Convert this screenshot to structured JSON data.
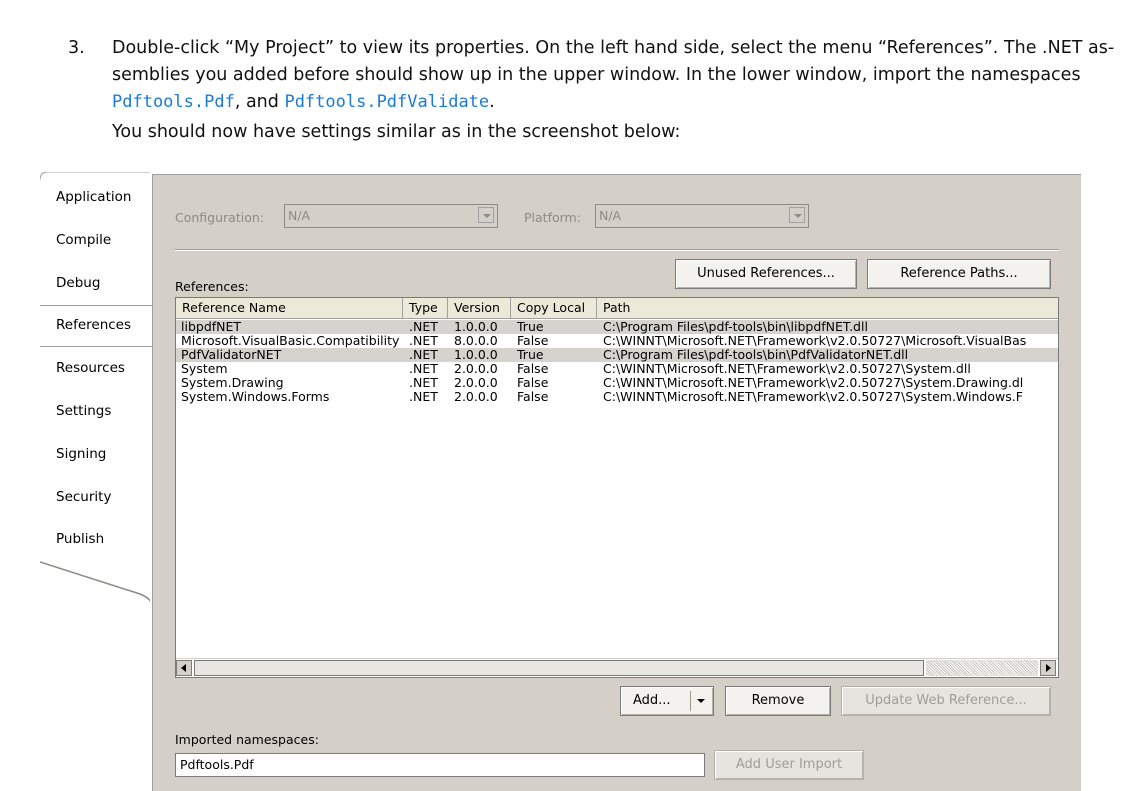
{
  "instruction": {
    "number": "3.",
    "line1": "Double-click “My Project” to view its properties. On the left hand side, select the menu “References”. The .NET as-",
    "line2": "semblies you added before should show up in the upper window. In the lower window, import the namespaces",
    "ns1": "Pdftools.Pdf",
    "mid": ", and ",
    "ns2": "Pdftools.PdfValidate",
    "end": ".",
    "line4": "You should now have settings similar as in the screenshot below:"
  },
  "sidebar": {
    "tabs": [
      "Application",
      "Compile",
      "Debug",
      "References",
      "Resources",
      "Settings",
      "Signing",
      "Security",
      "Publish"
    ],
    "active": "References"
  },
  "config": {
    "configuration_label": "Configuration:",
    "configuration_value": "N/A",
    "platform_label": "Platform:",
    "platform_value": "N/A"
  },
  "references": {
    "label": "References:",
    "unused_button": "Unused References...",
    "paths_button": "Reference Paths...",
    "columns": [
      "Reference Name",
      "Type",
      "Version",
      "Copy Local",
      "Path"
    ],
    "rows": [
      {
        "name": "libpdfNET",
        "type": ".NET",
        "version": "1.0.0.0",
        "copy": "True",
        "path": "C:\\Program Files\\pdf-tools\\bin\\libpdfNET.dll",
        "selected": true
      },
      {
        "name": "Microsoft.VisualBasic.Compatibility",
        "type": ".NET",
        "version": "8.0.0.0",
        "copy": "False",
        "path": "C:\\WINNT\\Microsoft.NET\\Framework\\v2.0.50727\\Microsoft.VisualBas",
        "selected": false
      },
      {
        "name": "PdfValidatorNET",
        "type": ".NET",
        "version": "1.0.0.0",
        "copy": "True",
        "path": "C:\\Program Files\\pdf-tools\\bin\\PdfValidatorNET.dll",
        "selected": true
      },
      {
        "name": "System",
        "type": ".NET",
        "version": "2.0.0.0",
        "copy": "False",
        "path": "C:\\WINNT\\Microsoft.NET\\Framework\\v2.0.50727\\System.dll",
        "selected": false
      },
      {
        "name": "System.Drawing",
        "type": ".NET",
        "version": "2.0.0.0",
        "copy": "False",
        "path": "C:\\WINNT\\Microsoft.NET\\Framework\\v2.0.50727\\System.Drawing.dl",
        "selected": false
      },
      {
        "name": "System.Windows.Forms",
        "type": ".NET",
        "version": "2.0.0.0",
        "copy": "False",
        "path": "C:\\WINNT\\Microsoft.NET\\Framework\\v2.0.50727\\System.Windows.F",
        "selected": false
      }
    ]
  },
  "actions": {
    "add_button": "Add...",
    "remove_button": "Remove",
    "update_button": "Update Web Reference..."
  },
  "imports": {
    "label": "Imported namespaces:",
    "value": "Pdftools.Pdf",
    "add_user_import": "Add User Import"
  }
}
